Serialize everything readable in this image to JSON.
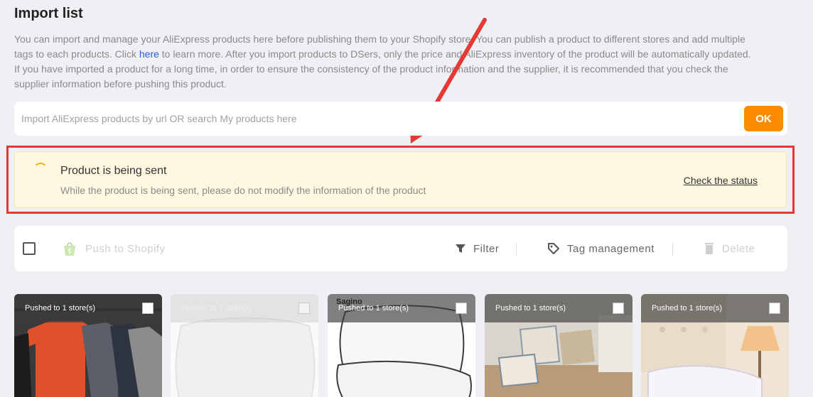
{
  "page": {
    "title": "Import list",
    "description_before_link": "You can import and manage your AliExpress products here before publishing them to your Shopify store. You can publish a product to different stores and add multiple tags to each products. Click ",
    "description_link": "here",
    "description_after_link": " to learn more. After you import products to DSers, only the price and AliExpress inventory of the product will be automatically updated. If you have imported a product for a long time, in order to ensure the consistency of the product information and the supplier, it is recommended that you check the supplier information before pushing this product."
  },
  "search": {
    "placeholder": "Import AliExpress products by url OR search My products here",
    "ok_label": "OK"
  },
  "notice": {
    "title": "Product is being sent",
    "text": "While the product is being sent, please do not modify the information of the product",
    "link": "Check the status"
  },
  "toolbar": {
    "push_label": "Push to Shopify",
    "filter_label": "Filter",
    "tag_label": "Tag management",
    "delete_label": "Delete"
  },
  "cards": [
    {
      "status": "Pushed to 1 store(s)",
      "image": "clothes-rack-image",
      "faded": false
    },
    {
      "status": "Pushed to 1 store(s)",
      "image": "pillow-image",
      "faded": true
    },
    {
      "status": "Pushed to 1 store(s)",
      "image": "pillows-image",
      "faded": false,
      "brand": "Sagino"
    },
    {
      "status": "Pushed to 1 store(s)",
      "image": "cushions-image",
      "faded": false
    },
    {
      "status": "Pushed to 1 store(s)",
      "image": "bed-pillows-image",
      "faded": false
    }
  ],
  "colors": {
    "accent": "#fb8c00",
    "highlight": "#e53935",
    "notice_bg": "#fff8e1",
    "link": "#2b5bd7"
  }
}
